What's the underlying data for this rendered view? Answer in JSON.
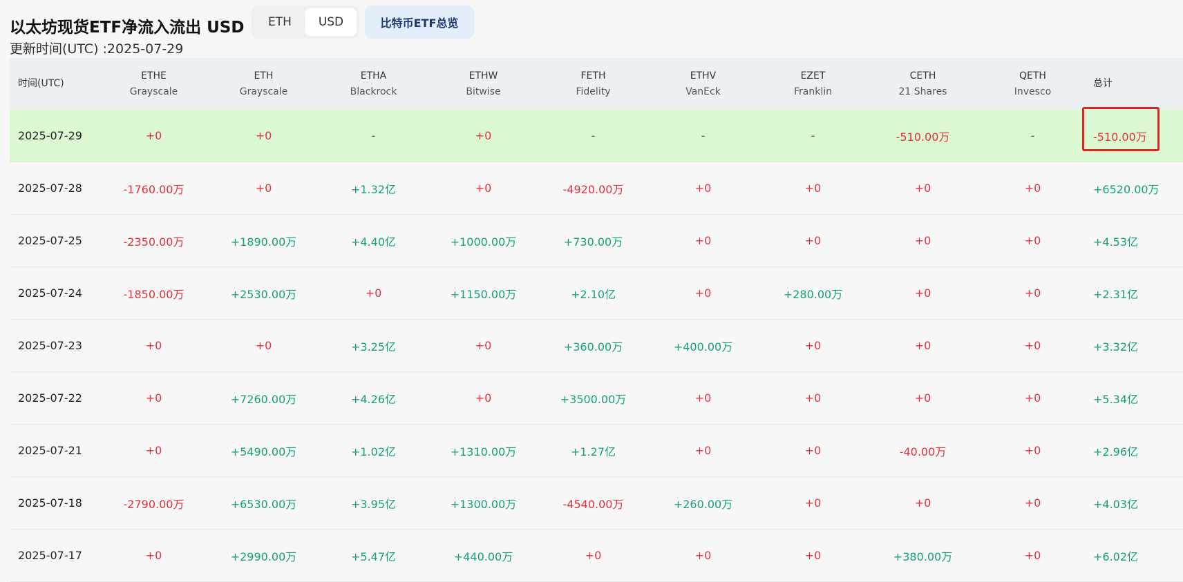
{
  "header": {
    "title": "以太坊现货ETF净流入流出 USD",
    "toggle": [
      "ETH",
      "USD"
    ],
    "active_toggle": "USD",
    "btc_overview_button": "比特币ETF总览",
    "update_time": "更新时间(UTC) :2025-07-29"
  },
  "table": {
    "date_header": "时间(UTC)",
    "total_header": "总计",
    "columns": [
      {
        "ticker": "ETHE",
        "issuer": "Grayscale"
      },
      {
        "ticker": "ETH",
        "issuer": "Grayscale"
      },
      {
        "ticker": "ETHA",
        "issuer": "Blackrock"
      },
      {
        "ticker": "ETHW",
        "issuer": "Bitwise"
      },
      {
        "ticker": "FETH",
        "issuer": "Fidelity"
      },
      {
        "ticker": "ETHV",
        "issuer": "VanEck"
      },
      {
        "ticker": "EZET",
        "issuer": "Franklin"
      },
      {
        "ticker": "CETH",
        "issuer": "21 Shares"
      },
      {
        "ticker": "QETH",
        "issuer": "Invesco"
      }
    ],
    "rows": [
      {
        "date": "2025-07-29",
        "highlighted": true,
        "values": [
          "+0",
          "+0",
          "-",
          "+0",
          "-",
          "-",
          "-",
          "-510.00万",
          "-"
        ],
        "total": "-510.00万"
      },
      {
        "date": "2025-07-28",
        "values": [
          "-1760.00万",
          "+0",
          "+1.32亿",
          "+0",
          "-4920.00万",
          "+0",
          "+0",
          "+0",
          "+0"
        ],
        "total": "+6520.00万"
      },
      {
        "date": "2025-07-25",
        "values": [
          "-2350.00万",
          "+1890.00万",
          "+4.40亿",
          "+1000.00万",
          "+730.00万",
          "+0",
          "+0",
          "+0",
          "+0"
        ],
        "total": "+4.53亿"
      },
      {
        "date": "2025-07-24",
        "values": [
          "-1850.00万",
          "+2530.00万",
          "+0",
          "+1150.00万",
          "+2.10亿",
          "+0",
          "+280.00万",
          "+0",
          "+0"
        ],
        "total": "+2.31亿"
      },
      {
        "date": "2025-07-23",
        "values": [
          "+0",
          "+0",
          "+3.25亿",
          "+0",
          "+360.00万",
          "+400.00万",
          "+0",
          "+0",
          "+0"
        ],
        "total": "+3.32亿"
      },
      {
        "date": "2025-07-22",
        "values": [
          "+0",
          "+7260.00万",
          "+4.26亿",
          "+0",
          "+3500.00万",
          "+0",
          "+0",
          "+0",
          "+0"
        ],
        "total": "+5.34亿"
      },
      {
        "date": "2025-07-21",
        "values": [
          "+0",
          "+5490.00万",
          "+1.02亿",
          "+1310.00万",
          "+1.27亿",
          "+0",
          "+0",
          "-40.00万",
          "+0"
        ],
        "total": "+2.96亿"
      },
      {
        "date": "2025-07-18",
        "values": [
          "-2790.00万",
          "+6530.00万",
          "+3.95亿",
          "+1300.00万",
          "-4540.00万",
          "+260.00万",
          "+0",
          "+0",
          "+0"
        ],
        "total": "+4.03亿"
      },
      {
        "date": "2025-07-17",
        "values": [
          "+0",
          "+2990.00万",
          "+5.47亿",
          "+440.00万",
          "+0",
          "+0",
          "+0",
          "+380.00万",
          "+0"
        ],
        "total": "+6.02亿"
      }
    ]
  },
  "colors": {
    "positive": "#14a07b",
    "negative": "#e0313c",
    "highlight_row": "#dbf8d2",
    "annotation_box": "#e0231c"
  }
}
